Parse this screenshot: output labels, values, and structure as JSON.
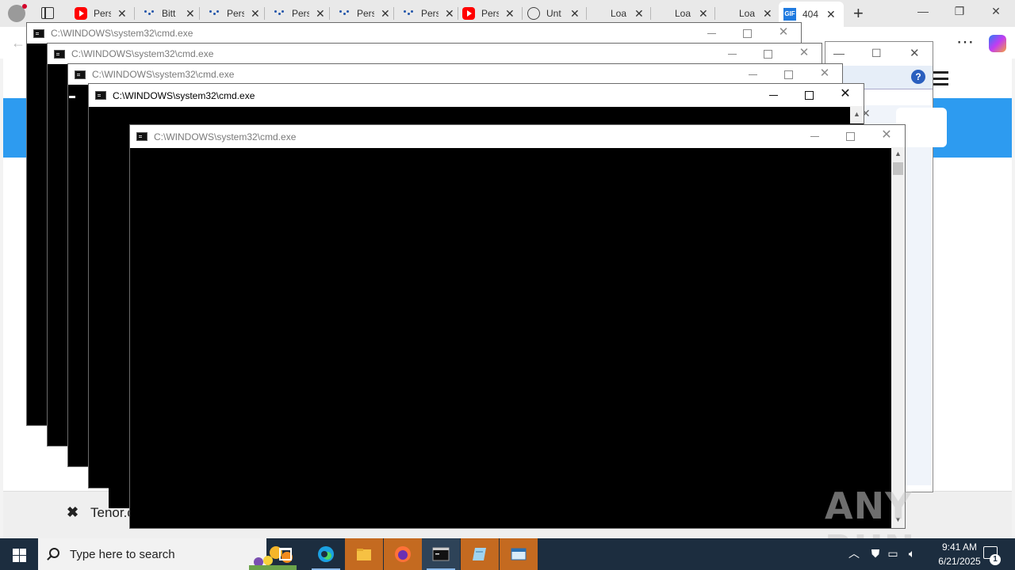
{
  "browser": {
    "tabs": [
      {
        "label": "Pers",
        "icon": "youtube-icon"
      },
      {
        "label": "Bitt",
        "icon": "dot-icon"
      },
      {
        "label": "Pers",
        "icon": "dots-icon"
      },
      {
        "label": "Pers",
        "icon": "dots-icon"
      },
      {
        "label": "Pers",
        "icon": "dots-icon"
      },
      {
        "label": "Pers",
        "icon": "dots-icon"
      },
      {
        "label": "Pers",
        "icon": "youtube-icon"
      },
      {
        "label": "Unt",
        "icon": "globe-icon"
      },
      {
        "label": "Loa",
        "icon": "blank-icon"
      },
      {
        "label": "Loa",
        "icon": "blank-icon"
      },
      {
        "label": "Loa",
        "icon": "blank-icon"
      },
      {
        "label": "404",
        "icon": "gif-icon",
        "active": true
      }
    ],
    "gif_icon_text": "GIF",
    "new_tab": "+",
    "close_glyph": "✕"
  },
  "page": {
    "bottom_bar_text": "Tenor.c",
    "dialog_help": "?"
  },
  "cmd_windows": [
    {
      "title": "C:\\WINDOWS\\system32\\cmd.exe"
    },
    {
      "title": "C:\\WINDOWS\\system32\\cmd.exe"
    },
    {
      "title": "C:\\WINDOWS\\system32\\cmd.exe"
    },
    {
      "title": "C:\\WINDOWS\\system32\\cmd.exe"
    },
    {
      "title": "C:\\WINDOWS\\system32\\cmd.exe"
    }
  ],
  "watermark": "ANY RUN",
  "taskbar": {
    "search_placeholder": "Type here to search",
    "time": "9:41 AM",
    "date": "6/21/2025",
    "notification_count": "1"
  },
  "colors": {
    "taskbar": "#1c2d3f",
    "banner": "#2d9bf0",
    "console": "#000000"
  }
}
